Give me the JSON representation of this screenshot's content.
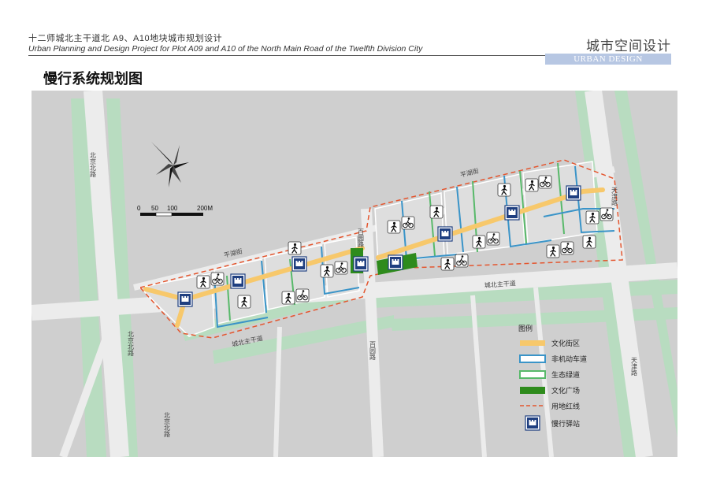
{
  "header": {
    "title_cn": "十二师城北主干道北 A9、A10地块城市规划设计",
    "title_en": "Urban Planning and Design Project for Plot A09 and A10 of the North Main Road of the Twelfth Division City",
    "brand_cn": "城市空间设计",
    "brand_en": "URBAN DESIGN"
  },
  "page_title": "慢行系统规划图",
  "scale_bar": {
    "ticks": [
      "0",
      "50",
      "100",
      "200M"
    ]
  },
  "road_labels": {
    "beijing_north_1": "北京北路",
    "beijing_north_2": "北京北路",
    "beijing_north_3": "北京北路",
    "pinghu_1": "平湖街",
    "pinghu_2": "平湖街",
    "baiyuan_1": "百园路",
    "baiyuan_2": "百园路",
    "chengbei_1": "城北主干道",
    "chengbei_2": "城北主干道",
    "tianjin_1": "天津路",
    "tianjin_2": "天津路"
  },
  "legend": {
    "title": "图例",
    "items": [
      {
        "label": "文化街区",
        "kind": "culture-street",
        "color": "#f7c86b"
      },
      {
        "label": "非机动车道",
        "kind": "bike-lane",
        "color": "#3a94c8"
      },
      {
        "label": "生态绿道",
        "kind": "greenway",
        "color": "#58b96a"
      },
      {
        "label": "文化广场",
        "kind": "culture-plaza",
        "color": "#2e8b1c"
      },
      {
        "label": "用地红线",
        "kind": "boundary",
        "color": "#e4562f"
      },
      {
        "label": "慢行驿站",
        "kind": "station",
        "color": "#1f3f80"
      }
    ]
  },
  "colors": {
    "map_bg": "#cfcfcf",
    "road": "#e9e9e9",
    "green": "#b8dcc0",
    "block": "#dedede",
    "culture_street": "#f7c86b",
    "bike_lane": "#3a94c8",
    "greenway": "#58b96a",
    "plaza": "#2e8b1c",
    "boundary": "#e4562f",
    "station": "#1f3f80"
  }
}
